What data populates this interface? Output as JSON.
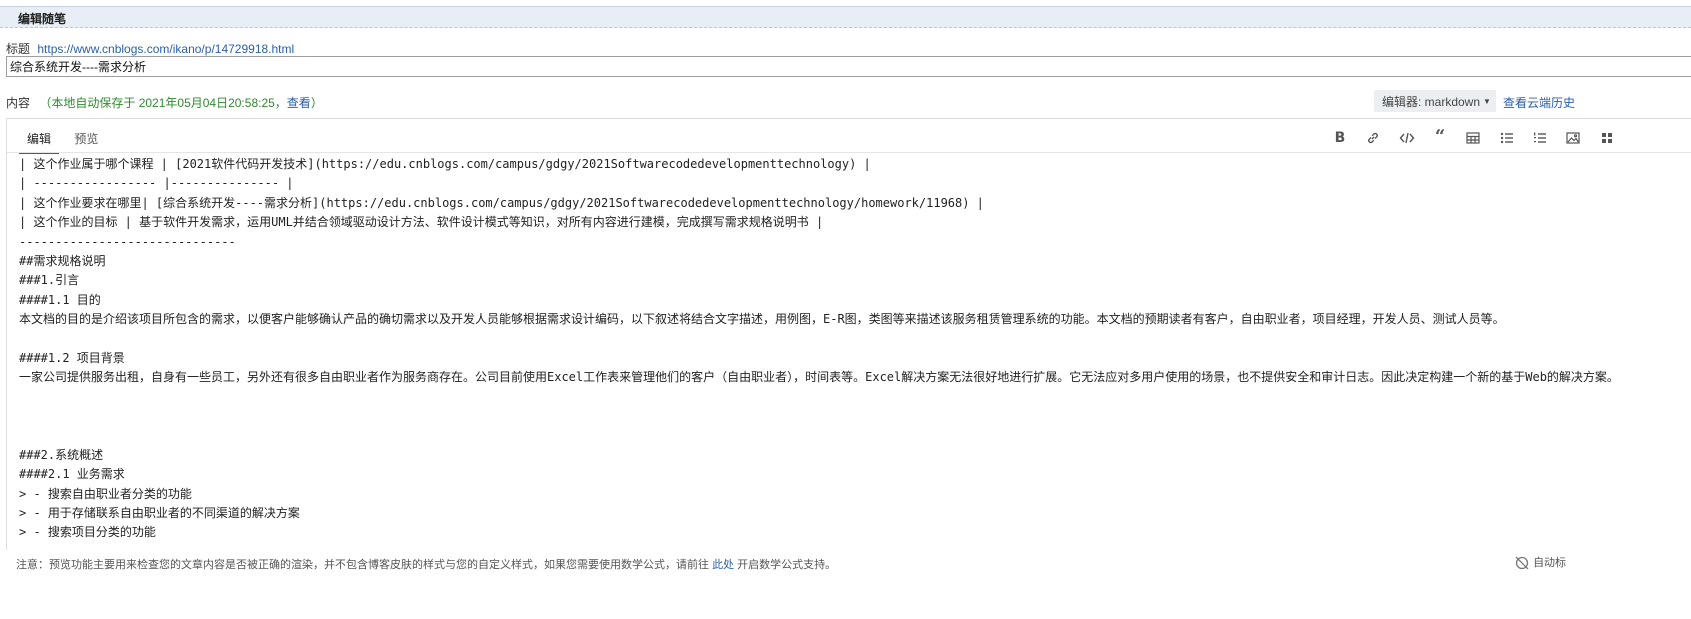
{
  "header": {
    "title": "编辑随笔"
  },
  "post": {
    "title_label": "标题",
    "url": "https://www.cnblogs.com/ikano/p/14729918.html",
    "title_value": "综合系统开发----需求分析"
  },
  "content": {
    "label": "内容",
    "autosave_text": "（本地自动保存于 2021年05月04日20:58:25，",
    "autosave_link": "查看",
    "autosave_close": "）"
  },
  "editor": {
    "selector_label": "编辑器: markdown",
    "cloud_history": "查看云端历史",
    "tabs": [
      "编辑",
      "预览"
    ],
    "toolbar_icons": [
      "bold-icon",
      "link-icon",
      "code-icon",
      "quote-icon",
      "table-icon",
      "unordered-list-icon",
      "ordered-list-icon",
      "image-icon",
      "more-icon"
    ],
    "lines": [
      "| 这个作业属于哪个课程 | [2021软件代码开发技术](https://edu.cnblogs.com/campus/gdgy/2021Softwarecodedevelopmenttechnology) |",
      "| ----------------- |--------------- |",
      "| 这个作业要求在哪里| [综合系统开发----需求分析](https://edu.cnblogs.com/campus/gdgy/2021Softwarecodedevelopmenttechnology/homework/11968) |",
      "| 这个作业的目标 | 基于软件开发需求，运用UML并结合领域驱动设计方法、软件设计模式等知识，对所有内容进行建模，完成撰写需求规格说明书 |",
      "------------------------------",
      "##需求规格说明",
      "###1.引言",
      "####1.1 目的",
      "本文档的目的是介绍该项目所包含的需求，以便客户能够确认产品的确切需求以及开发人员能够根据需求设计编码，以下叙述将结合文字描述，用例图，E-R图，类图等来描述该服务租赁管理系统的功能。本文档的预期读者有客户，自由职业者，项目经理，开发人员、测试人员等。",
      "####1.2 项目背景",
      "一家公司提供服务出租，自身有一些员工，另外还有很多自由职业者作为服务商存在。公司目前使用Excel工作表来管理他们的客户（自由职业者），时间表等。Excel解决方案无法很好地进行扩展。它无法应对多用户使用的场景，也不提供安全和审计日志。因此决定构建一个新的基于Web的解决方案。",
      "",
      "",
      "###2.系统概述",
      "####2.1 业务需求",
      "> - 搜索自由职业者分类的功能",
      "> - 用于存储联系自由职业者的不同渠道的解决方案",
      "> - 搜索项目分类的功能"
    ]
  },
  "footer": {
    "note_prefix": "注意：预览功能主要用来检查您的文章内容是否被正确的渲染，并不包含博客皮肤的样式与您的自定义样式，如果您需要使用数学公式，请前往",
    "note_link": "此处",
    "note_suffix": "开启数学公式支持。",
    "right_text": "自动标"
  }
}
